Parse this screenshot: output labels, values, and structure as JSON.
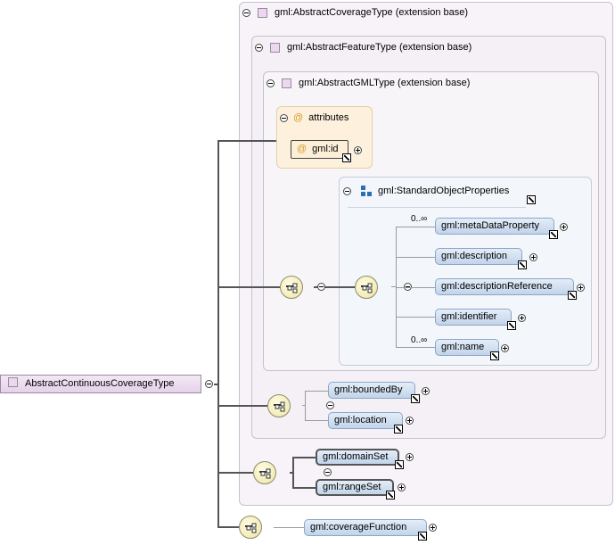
{
  "root": {
    "label": "AbstractContinuousCoverageType"
  },
  "extensions": [
    {
      "label": "gml:AbstractCoverageType (extension base)"
    },
    {
      "label": "gml:AbstractFeatureType (extension base)"
    },
    {
      "label": "gml:AbstractGMLType (extension base)"
    }
  ],
  "attributes": {
    "title": "attributes",
    "items": [
      "gml:id"
    ]
  },
  "group": {
    "label": "gml:StandardObjectProperties"
  },
  "standard_elements": [
    {
      "label": "gml:metaDataProperty",
      "occurs": "0..∞"
    },
    {
      "label": "gml:description"
    },
    {
      "label": "gml:descriptionReference"
    },
    {
      "label": "gml:identifier"
    },
    {
      "label": "gml:name",
      "occurs": "0..∞"
    }
  ],
  "feature_elements": [
    "gml:boundedBy",
    "gml:location"
  ],
  "coverage_elements": [
    "gml:domainSet",
    "gml:rangeSet"
  ],
  "continuous_elements": [
    "gml:coverageFunction"
  ],
  "colors": {
    "element_fill": "#c2d4ea",
    "type_fill": "#ebd8ef",
    "compositor_fill": "#ede5a8",
    "attribute_fill": "#fdf1dd"
  }
}
